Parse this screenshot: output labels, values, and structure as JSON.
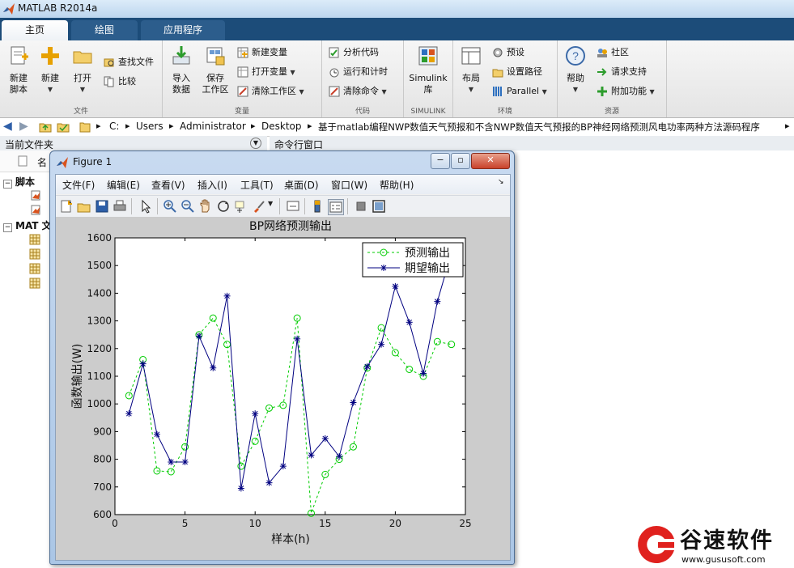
{
  "app": {
    "title": "MATLAB R2014a"
  },
  "tabs": [
    {
      "label": "主页"
    },
    {
      "label": "绘图"
    },
    {
      "label": "应用程序"
    }
  ],
  "ribbon": {
    "file": {
      "label": "文件",
      "new_script": "新建\n脚本",
      "new": "新建",
      "open": "打开",
      "find_files": "查找文件",
      "compare": "比较"
    },
    "variable": {
      "label": "变量",
      "import": "导入\n数据",
      "save_ws": "保存\n工作区",
      "new_var": "新建变量",
      "open_var": "打开变量",
      "clear_ws": "清除工作区"
    },
    "code": {
      "label": "代码",
      "analyze": "分析代码",
      "run_time": "运行和计时",
      "clear_cmd": "清除命令"
    },
    "simulink": {
      "label": "SIMULINK",
      "lib": "Simulink\n库"
    },
    "env": {
      "label": "环境",
      "layout": "布局",
      "prefs": "预设",
      "set_path": "设置路径",
      "parallel": "Parallel"
    },
    "resources": {
      "label": "资源",
      "help": "帮助",
      "community": "社区",
      "support": "请求支持",
      "addons": "附加功能"
    }
  },
  "address": {
    "crumbs": [
      "C:",
      "Users",
      "Administrator",
      "Desktop",
      "基于matlab编程NWP数值天气预报和不含NWP数值天气预报的BP神经网络预测风电功率两种方法源码程序"
    ]
  },
  "panels": {
    "current_folder": "当前文件夹",
    "command_window": "命令行窗口",
    "name_col": "名",
    "scripts_group": "脚本",
    "mat_group": "MAT 文"
  },
  "figure": {
    "title": "Figure 1",
    "menu": [
      "文件(F)",
      "编辑(E)",
      "查看(V)",
      "插入(I)",
      "工具(T)",
      "桌面(D)",
      "窗口(W)",
      "帮助(H)"
    ]
  },
  "chart_data": {
    "type": "line",
    "title": "BP网络预测输出",
    "xlabel": "样本(h)",
    "ylabel": "函数输出(W)",
    "xlim": [
      0,
      25
    ],
    "ylim": [
      600,
      1600
    ],
    "xticks": [
      0,
      5,
      10,
      15,
      20,
      25
    ],
    "yticks": [
      600,
      700,
      800,
      900,
      1000,
      1100,
      1200,
      1300,
      1400,
      1500,
      1600
    ],
    "grid": false,
    "legend_position": "top-right",
    "x": [
      1,
      2,
      3,
      4,
      5,
      6,
      7,
      8,
      9,
      10,
      11,
      12,
      13,
      14,
      15,
      16,
      17,
      18,
      19,
      20,
      21,
      22,
      23,
      24
    ],
    "series": [
      {
        "name": "预测输出",
        "color": "#00cc00",
        "line": "dashed",
        "marker": "circle",
        "values": [
          1030,
          1160,
          758,
          755,
          845,
          1250,
          1310,
          1215,
          775,
          865,
          985,
          995,
          1310,
          605,
          745,
          800,
          845,
          1130,
          1275,
          1185,
          1125,
          1100,
          1225,
          1215
        ]
      },
      {
        "name": "期望输出",
        "color": "#000080",
        "line": "solid",
        "marker": "star",
        "values": [
          965,
          1145,
          890,
          790,
          790,
          1245,
          1130,
          1390,
          695,
          965,
          715,
          775,
          1235,
          815,
          875,
          810,
          1005,
          1135,
          1215,
          1425,
          1295,
          1110,
          1370,
          1545
        ]
      }
    ]
  },
  "watermark": {
    "brand": "谷速软件",
    "url": "www.gususoft.com"
  }
}
